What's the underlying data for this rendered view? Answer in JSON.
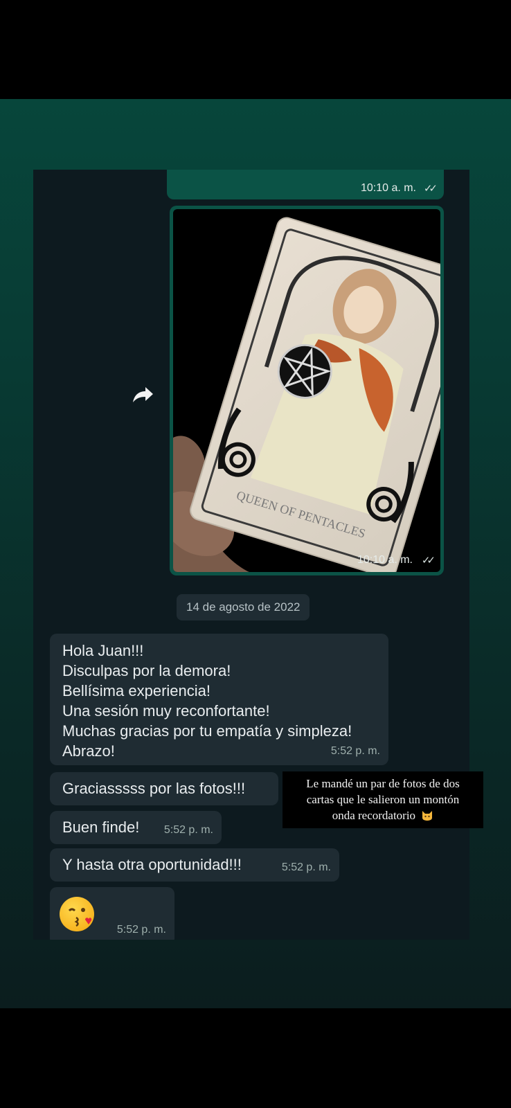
{
  "chat": {
    "top_bubble": {
      "time": "10:10 a. m.",
      "status": "read"
    },
    "image_message": {
      "time": "10:10 a. m.",
      "status": "read",
      "card_caption": "QUEEN OF PENTACLES"
    },
    "date_separator": "14 de agosto de 2022",
    "messages": [
      {
        "lines": [
          "Hola Juan!!!",
          "Disculpas por la demora!",
          "Bellísima experiencia!",
          "Una sesión muy reconfortante!",
          "Muchas gracias por tu empatía y simpleza!",
          "Abrazo!"
        ],
        "time": "5:52 p. m."
      },
      {
        "text": "Graciasssss por las fotos!!!",
        "time": "5:52 p. m."
      },
      {
        "text": "Buen finde!",
        "time": "5:52 p. m."
      },
      {
        "text": "Y hasta otra oportunidad!!!",
        "time": "5:52 p. m."
      },
      {
        "emoji": "kissing-face-with-heart",
        "time": "5:52 p. m."
      }
    ]
  },
  "caption": {
    "lines": [
      "Le mandé un par de fotos de dos",
      "cartas que le salieron un montón",
      "onda recordatorio"
    ],
    "emoji": "cat-face"
  },
  "colors": {
    "outgoing_bubble": "#0b5346",
    "incoming_bubble": "#1f2c33",
    "chat_background": "#0d1a1f",
    "story_background": "#07463b"
  }
}
